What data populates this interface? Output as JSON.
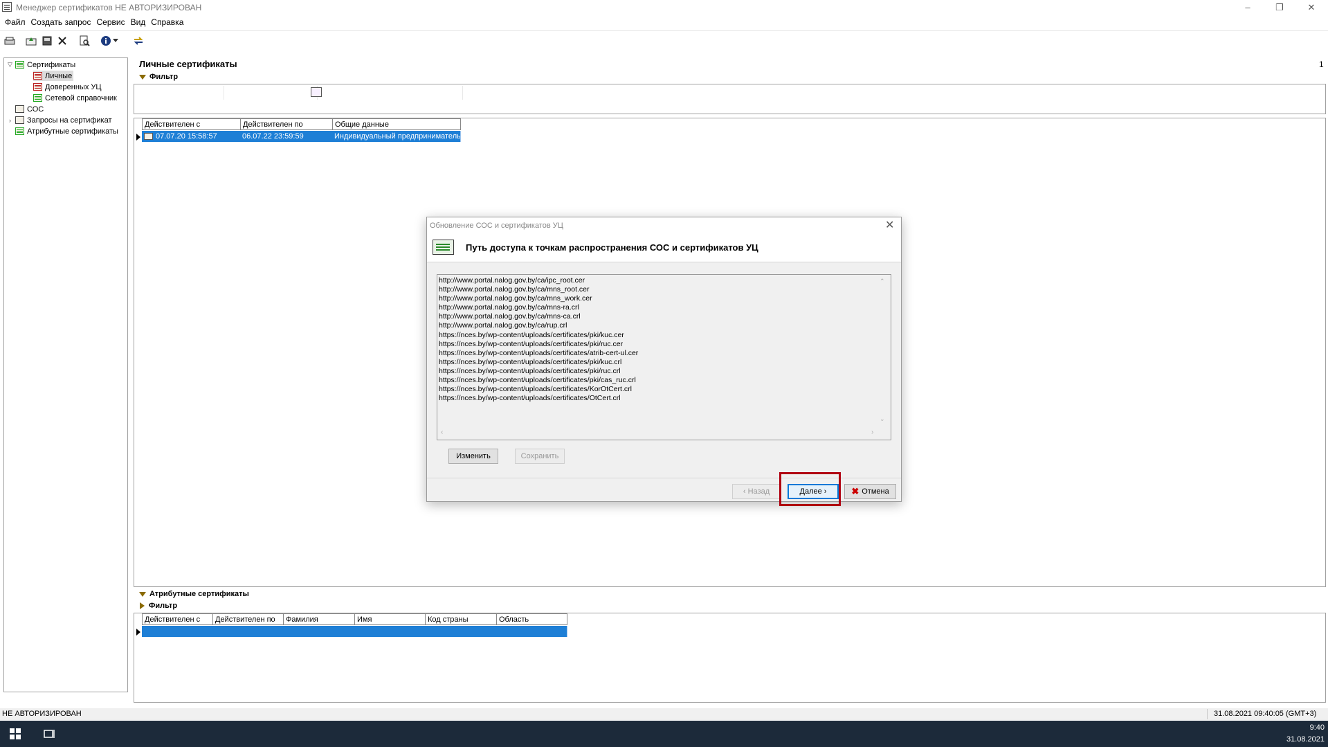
{
  "window": {
    "title": "Менеджер сертификатов  НЕ АВТОРИЗИРОВАН",
    "minimize": "–",
    "maximize": "❐",
    "close": "✕"
  },
  "menu": [
    "Файл",
    "Создать запрос",
    "Сервис",
    "Вид",
    "Справка"
  ],
  "tree": {
    "items": [
      {
        "label": "Сертификаты"
      },
      {
        "label": "Личные"
      },
      {
        "label": "Доверенных УЦ"
      },
      {
        "label": "Сетевой справочник"
      },
      {
        "label": "СОС"
      },
      {
        "label": "Запросы на сертификат"
      },
      {
        "label": "Атрибутные сертификаты"
      }
    ]
  },
  "main": {
    "title": "Личные сертификаты",
    "page": "1",
    "filter_label": "Фильтр",
    "columns": [
      "Действителен с",
      "Действителен по",
      "Общие данные"
    ],
    "rows": [
      [
        "07.07.20 15:58:57",
        "06.07.22 23:59:59",
        "Индивидуальный предприниматель"
      ]
    ]
  },
  "attr": {
    "title": "Атрибутные сертификаты",
    "filter_label": "Фильтр",
    "columns": [
      "Действителен с",
      "Действителен по",
      "Фамилия",
      "Имя",
      "Код страны",
      "Область"
    ]
  },
  "status": {
    "left": "НЕ АВТОРИЗИРОВАН",
    "right": "31.08.2021 09:40:05 (GMT+3)"
  },
  "taskbar": {
    "time": "9:40",
    "date": "31.08.2021"
  },
  "dialog": {
    "title": "Обновление СОС и сертификатов УЦ",
    "heading": "Путь доступа к точкам распространения СОС  и сертификатов УЦ",
    "urls": [
      "http://www.portal.nalog.gov.by/ca/ipc_root.cer",
      "http://www.portal.nalog.gov.by/ca/mns_root.cer",
      "http://www.portal.nalog.gov.by/ca/mns_work.cer",
      "http://www.portal.nalog.gov.by/ca/mns-ra.crl",
      "http://www.portal.nalog.gov.by/ca/mns-ca.crl",
      "http://www.portal.nalog.gov.by/ca/rup.crl",
      "https://nces.by/wp-content/uploads/certificates/pki/kuc.cer",
      "https://nces.by/wp-content/uploads/certificates/pki/ruc.cer",
      "https://nces.by/wp-content/uploads/certificates/atrib-cert-ul.cer",
      "https://nces.by/wp-content/uploads/certificates/pki/kuc.crl",
      "https://nces.by/wp-content/uploads/certificates/pki/ruc.crl",
      "https://nces.by/wp-content/uploads/certificates/pki/cas_ruc.crl",
      "https://nces.by/wp-content/uploads/certificates/KorOtCert.crl",
      "https://nces.by/wp-content/uploads/certificates/OtCert.crl"
    ],
    "btn_change": "Изменить",
    "btn_save": "Сохранить",
    "btn_back": "‹ Назад",
    "btn_next": "Далее ›",
    "btn_cancel": "Отмена"
  }
}
